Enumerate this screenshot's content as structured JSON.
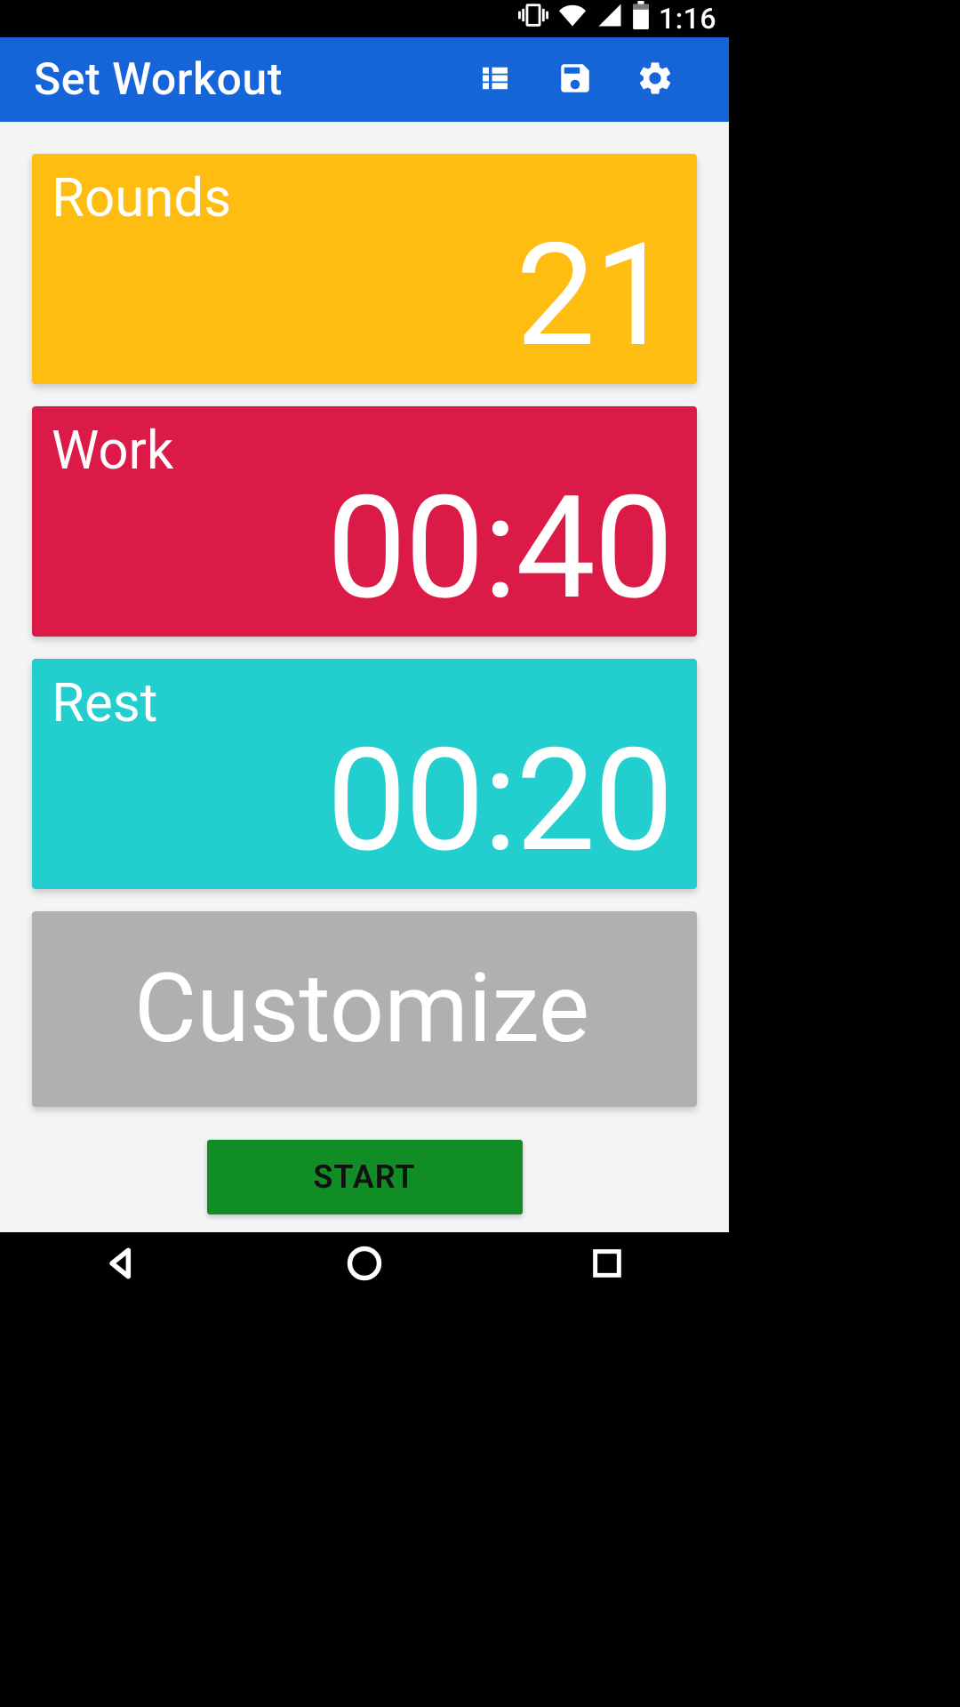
{
  "status": {
    "clock": "1:16"
  },
  "appbar": {
    "title": "Set Workout"
  },
  "cards": {
    "rounds": {
      "label": "Rounds",
      "value": "21"
    },
    "work": {
      "label": "Work",
      "value": "00:40"
    },
    "rest": {
      "label": "Rest",
      "value": "00:20"
    },
    "customize": {
      "label": "Customize"
    }
  },
  "buttons": {
    "start": "START"
  }
}
